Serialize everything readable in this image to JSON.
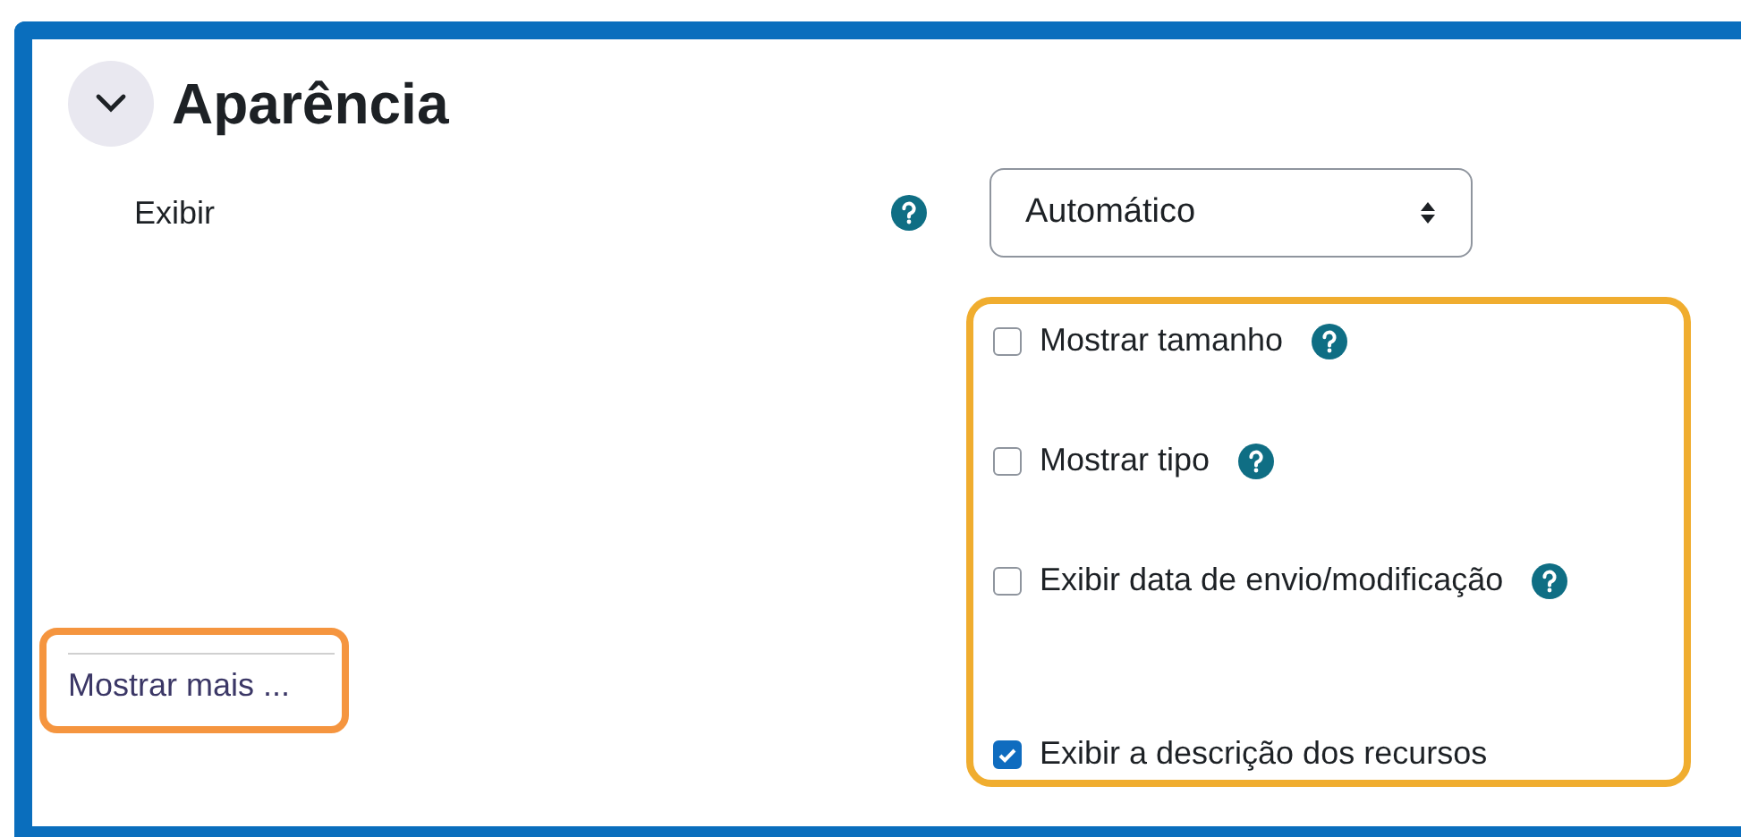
{
  "section": {
    "title": "Aparência",
    "expanded": true
  },
  "display": {
    "label": "Exibir",
    "value": "Automático"
  },
  "options": [
    {
      "label": "Mostrar tamanho",
      "checked": false,
      "help": true
    },
    {
      "label": "Mostrar tipo",
      "checked": false,
      "help": true
    },
    {
      "label": "Exibir data de envio/modificação",
      "checked": false,
      "help": true
    },
    {
      "label": "Exibir a descrição dos recursos",
      "checked": true,
      "help": false
    }
  ],
  "show_more": "Mostrar mais ..."
}
